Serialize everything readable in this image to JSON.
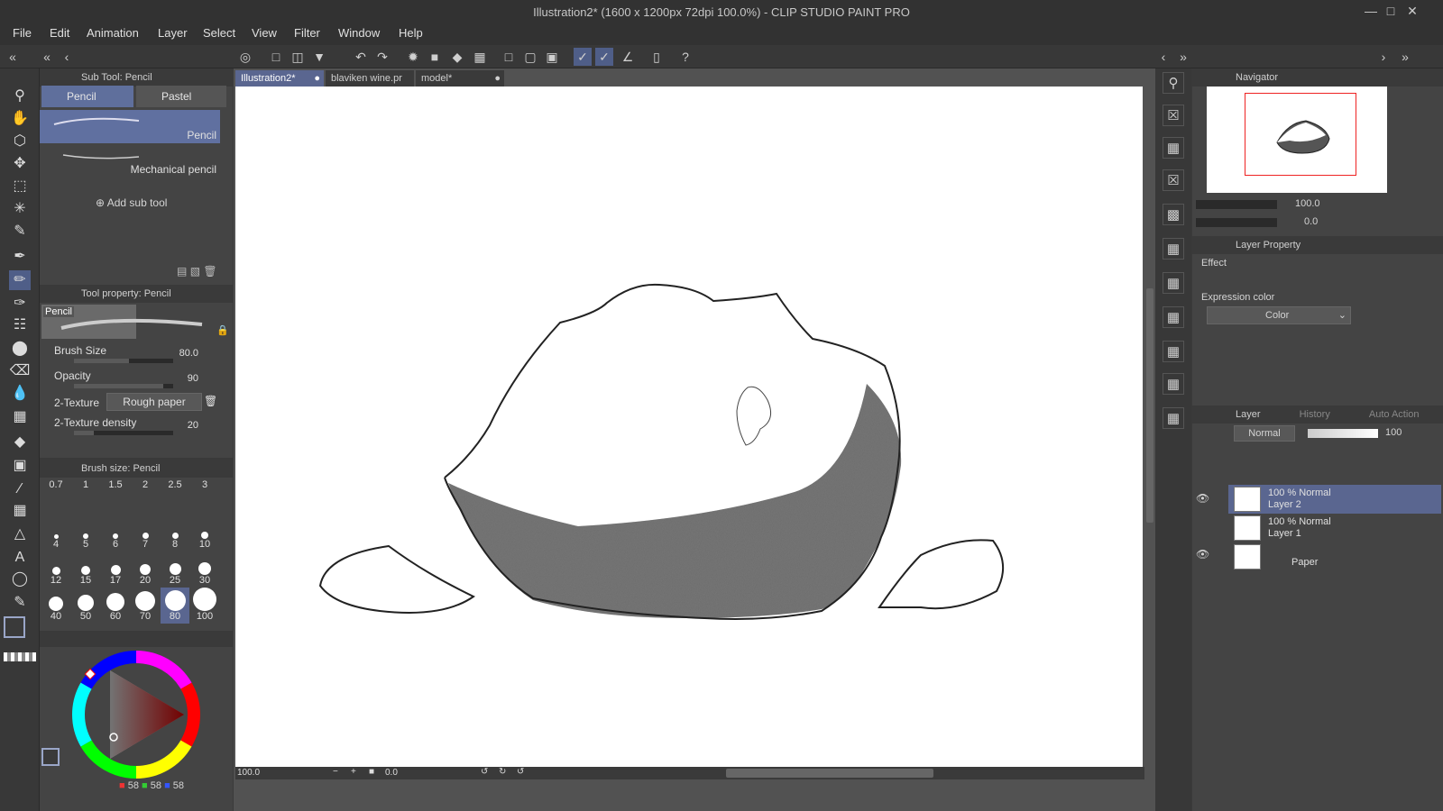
{
  "window": {
    "title": "Illustration2* (1600 x 1200px 72dpi 100.0%)  - CLIP STUDIO PAINT PRO"
  },
  "menu": [
    "File",
    "Edit",
    "Animation",
    "Layer",
    "Select",
    "View",
    "Filter",
    "Window",
    "Help"
  ],
  "subtool": {
    "header": "Sub Tool: Pencil",
    "tabs": [
      "Pencil",
      "Pastel"
    ],
    "items": [
      "Pencil",
      "Mechanical pencil"
    ],
    "add_label": "Add sub tool"
  },
  "toolprop": {
    "header": "Tool property: Pencil",
    "preview_label": "Pencil",
    "brush_size_label": "Brush Size",
    "brush_size_value": "80.0",
    "opacity_label": "Opacity",
    "opacity_value": "90",
    "texture_label": "2-Texture",
    "texture_value": "Rough paper",
    "density_label": "2-Texture density",
    "density_value": "20"
  },
  "brushsize": {
    "header": "Brush size: Pencil",
    "sizes": [
      "0.7",
      "1",
      "1.5",
      "2",
      "2.5",
      "3",
      "4",
      "5",
      "6",
      "7",
      "8",
      "10",
      "12",
      "15",
      "17",
      "20",
      "25",
      "30",
      "40",
      "50",
      "60",
      "70",
      "80",
      "100"
    ],
    "selected": "80"
  },
  "color": {
    "r": "58",
    "g": "58",
    "b": "58"
  },
  "tabs": [
    "Illustration2*",
    "blaviken wine.pr",
    "model*"
  ],
  "status": {
    "zoom": "100.0",
    "angle": "0.0"
  },
  "navigator": {
    "header": "Navigator",
    "zoom": "100.0",
    "rotate": "0.0"
  },
  "layerprop": {
    "header": "Layer Property",
    "effect_label": "Effect",
    "expression_label": "Expression color",
    "expression_value": "Color"
  },
  "layers": {
    "tabs": [
      "Layer",
      "History",
      "Auto Action"
    ],
    "blend_mode": "Normal",
    "opacity": "100",
    "items": [
      {
        "top": "100 % Normal",
        "name": "Layer 2"
      },
      {
        "top": "100 % Normal",
        "name": "Layer 1"
      },
      {
        "top": "",
        "name": "Paper"
      }
    ]
  }
}
